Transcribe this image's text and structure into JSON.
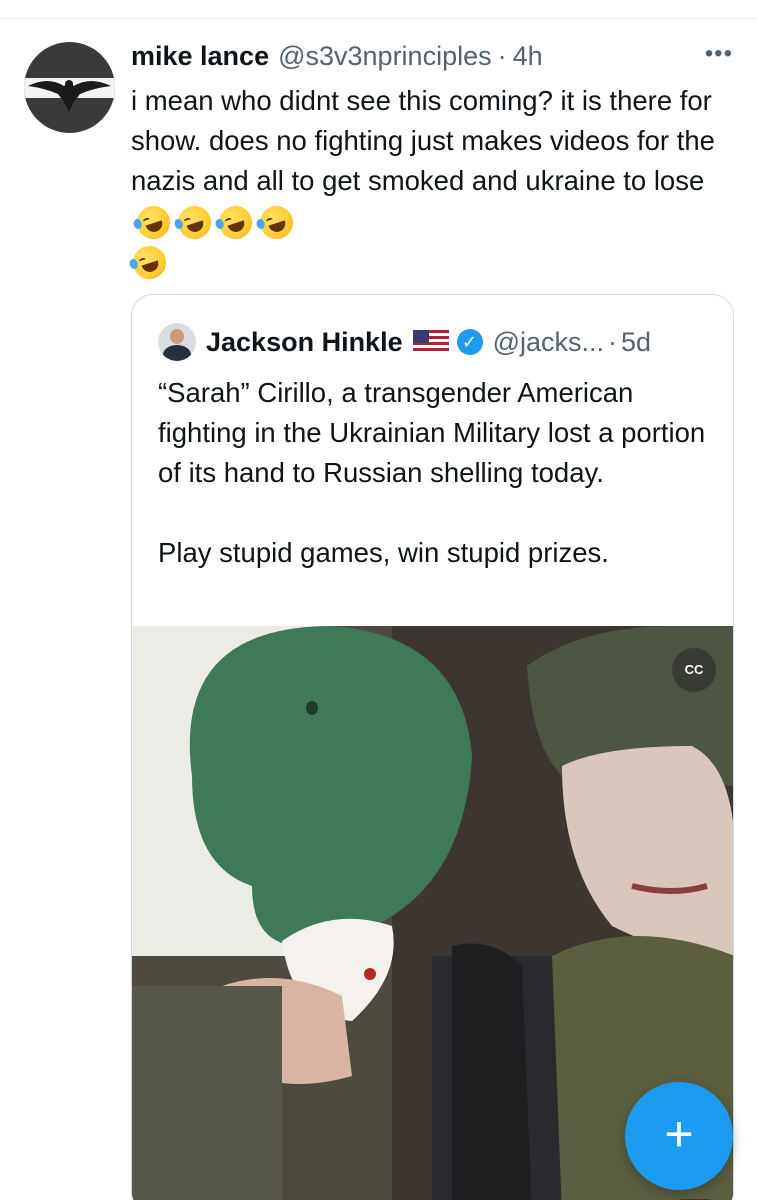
{
  "tweet": {
    "author_name": "mike lance",
    "handle": "@s3v3nprinciples",
    "separator": "·",
    "time": "4h",
    "more": "•••",
    "text": "i mean who didnt see this coming?  it is there for show.   does no fighting just makes videos for the nazis and all to get smoked and ukraine to lose",
    "emoji_icon": "rolling-on-floor-laughing-icon",
    "emoji_count": 5
  },
  "quote": {
    "author_name": "Jackson Hinkle",
    "flag_icon": "us-flag-icon",
    "verified_icon": "verified-badge-icon",
    "handle": "@jacks...",
    "separator": "·",
    "time": "5d",
    "text": "“Sarah” Cirillo, a transgender American fighting in the Ukrainian Military lost a portion of its hand to Russian shelling today.\n\nPlay stupid games, win stupid prizes.",
    "media": {
      "cc_label": "CC",
      "volume_label": "◁×"
    }
  },
  "compose": {
    "label": "+",
    "icon": "compose-plus-icon"
  },
  "colors": {
    "accent": "#1d9bf0",
    "text": "#0f1419",
    "secondary": "#536471",
    "border": "#cfd9de"
  }
}
